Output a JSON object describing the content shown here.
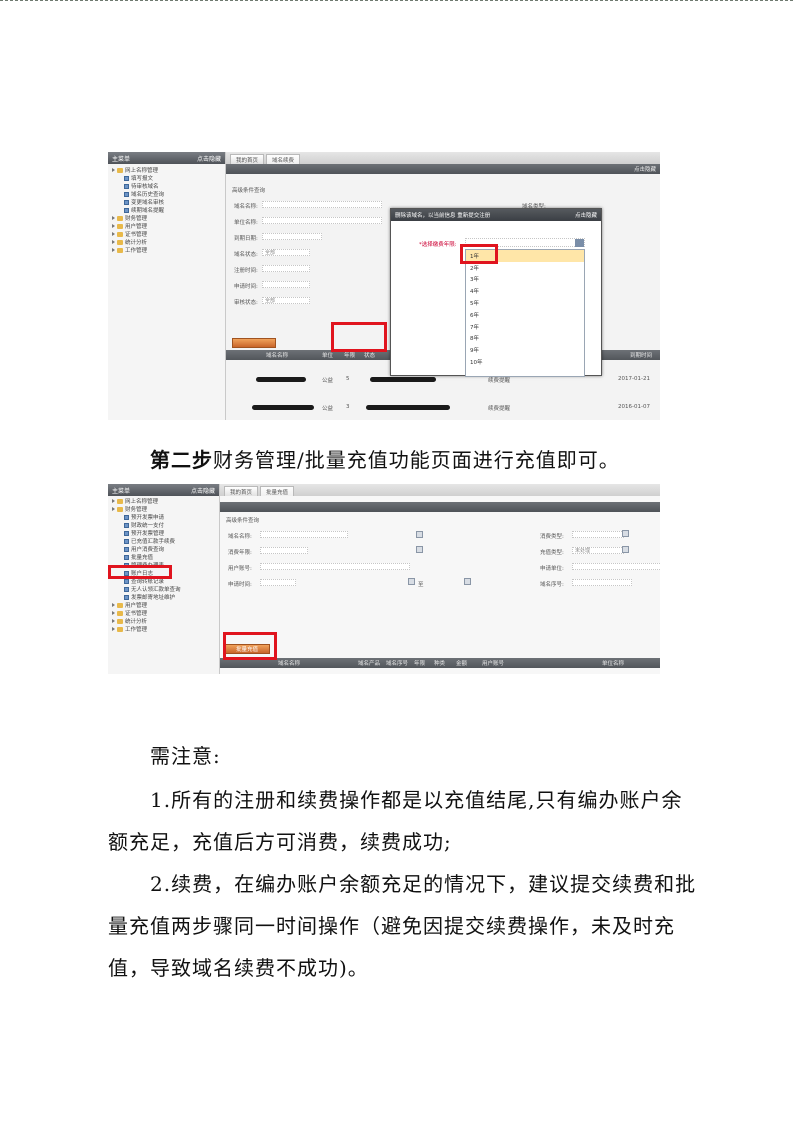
{
  "screenshot1": {
    "tree_title": "主菜单",
    "tree_hide": "点击隐藏",
    "tree_items": [
      {
        "label": "网上名称管理",
        "type": "folder"
      },
      {
        "label": "填写报文",
        "type": "leaf"
      },
      {
        "label": "待审核域名",
        "type": "leaf"
      },
      {
        "label": "域名历史查询",
        "type": "leaf"
      },
      {
        "label": "变更域名审核",
        "type": "leaf"
      },
      {
        "label": "续期域名提醒",
        "type": "leaf"
      },
      {
        "label": "财务管理",
        "type": "folder"
      },
      {
        "label": "用户管理",
        "type": "folder"
      },
      {
        "label": "证书管理",
        "type": "folder"
      },
      {
        "label": "统计分析",
        "type": "folder"
      },
      {
        "label": "工作管理",
        "type": "folder"
      }
    ],
    "tabs": [
      "我的首页",
      "域名续费"
    ],
    "bar_right": "点击隐藏",
    "section_title": "高级条件查询",
    "form": [
      {
        "label": "域名名称:",
        "value": ""
      },
      {
        "label": "单位名称:",
        "value": ""
      },
      {
        "label": "到期日期:",
        "value": ""
      },
      {
        "label": "域名状态:",
        "value": "全部"
      },
      {
        "label": "注册时间:",
        "value": ""
      },
      {
        "label": "申请时间:",
        "value": ""
      },
      {
        "label": "审核状态:",
        "value": "全部"
      }
    ],
    "right_label": "域名类型:",
    "dialog": {
      "title": "删除该域名，以当前信息 重新提交注册",
      "hide": "点击隐藏",
      "field_label": "*选择缴费年限:",
      "options": [
        "1年",
        "2年",
        "3年",
        "4年",
        "5年",
        "6年",
        "7年",
        "8年",
        "9年",
        "10年"
      ],
      "selected": "1年"
    },
    "action_button": "续 费",
    "grid_columns": [
      "域名名称",
      "单位",
      "年限",
      "状态",
      "到期时间"
    ],
    "rows": [
      {
        "c1": "公益",
        "c2": "5",
        "status": "续费提醒",
        "due": "2017-01-21"
      },
      {
        "c1": "公益",
        "c2": "3",
        "status": "续费提醒",
        "due": "2016-01-07"
      }
    ],
    "side_text": "每页"
  },
  "step2_prefix": "第二步",
  "step2_text": "财务管理/批量充值功能页面进行充值即可。",
  "screenshot2": {
    "tree_title": "主菜单",
    "tree_hide": "点击隐藏",
    "tree_items": [
      {
        "label": "网上名称管理",
        "type": "folder"
      },
      {
        "label": "财务管理",
        "type": "folder"
      },
      {
        "label": "预开发票申请",
        "type": "leaf"
      },
      {
        "label": "财政统一支付",
        "type": "leaf"
      },
      {
        "label": "预开发票管理",
        "type": "leaf"
      },
      {
        "label": "已充值汇款手续费",
        "type": "leaf"
      },
      {
        "label": "用户消费查询",
        "type": "leaf"
      },
      {
        "label": "批量充值",
        "type": "leaf"
      },
      {
        "label": "管理费办理表",
        "type": "leaf"
      },
      {
        "label": "账户日志",
        "type": "leaf"
      },
      {
        "label": "查询转账记录",
        "type": "leaf"
      },
      {
        "label": "无人认领汇款单查询",
        "type": "leaf"
      },
      {
        "label": "发票邮寄地址维护",
        "type": "leaf"
      },
      {
        "label": "用户管理",
        "type": "folder"
      },
      {
        "label": "证书管理",
        "type": "folder"
      },
      {
        "label": "统计分析",
        "type": "folder"
      },
      {
        "label": "工作管理",
        "type": "folder"
      }
    ],
    "tabs": [
      "我的首页",
      "批量充值"
    ],
    "section_title": "高级条件查询",
    "left_form": [
      {
        "label": "域名名称:",
        "value": ""
      },
      {
        "label": "消费年限:",
        "value": ""
      },
      {
        "label": "用户账号:",
        "value": ""
      },
      {
        "label": "申请时间:",
        "value": "至"
      }
    ],
    "right_form": [
      {
        "label": "消费类型:",
        "value": ""
      },
      {
        "label": "充值类型:",
        "value": "未处理"
      },
      {
        "label": "申请单位:",
        "value": ""
      },
      {
        "label": "域名序号:",
        "value": ""
      }
    ],
    "action_button": "批量充值",
    "grid_columns": [
      "域名名称",
      "域名产品",
      "域名序号",
      "年限",
      "种类",
      "金额",
      "用户账号",
      "单位名称"
    ]
  },
  "note_title": "需注意:",
  "note1_line1": "1.所有的注册和续费操作都是以充值结尾,只有编办账户余",
  "note1_line2": "额充足，充值后方可消费，续费成功;",
  "note2_line1": "2.续费，在编办账户余额充足的情况下，建议提交续费和批",
  "note2_line2": "量充值两步骤同一时间操作（避免因提交续费操作，未及时充",
  "note2_line3": "值，导致域名续费不成功)。"
}
